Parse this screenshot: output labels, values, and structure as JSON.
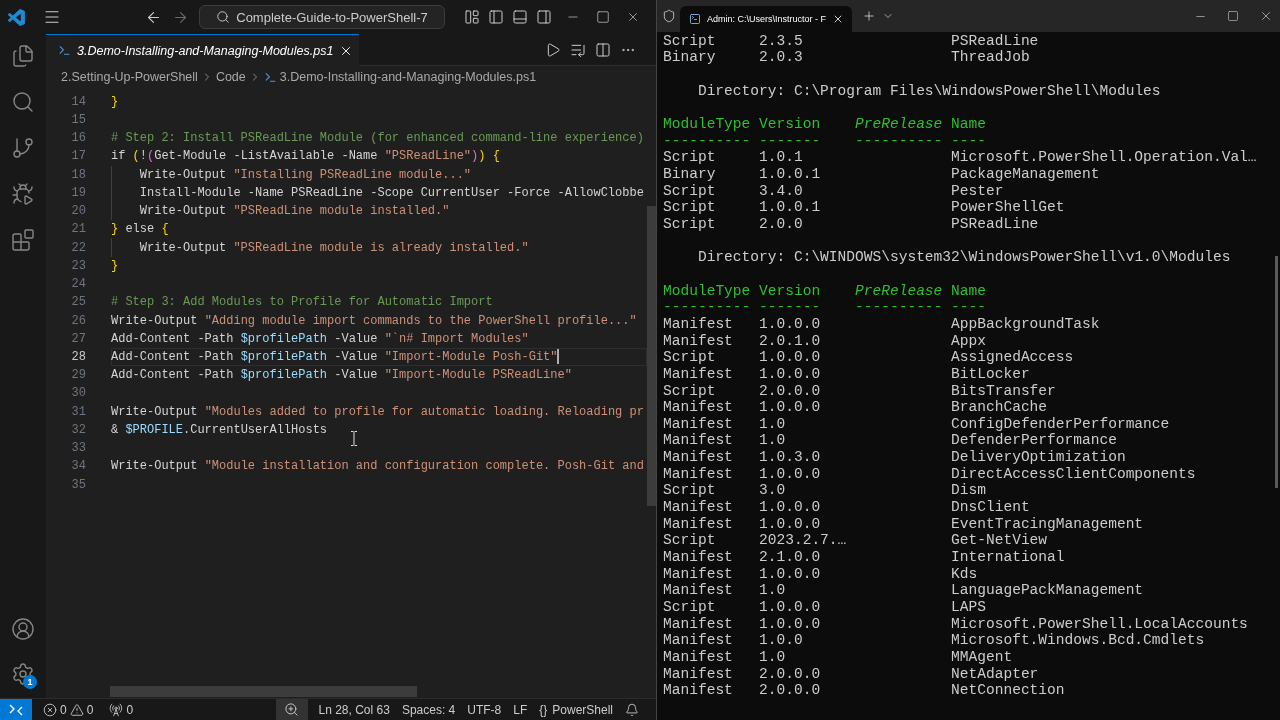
{
  "editor_window": {
    "search": "Complete-Guide-to-PowerShell-7",
    "settings_badge": "1",
    "tabs": [
      {
        "label": "3.Demo-Installing-and-Managing-Modules.ps1",
        "selected": true,
        "preview": true
      }
    ],
    "breadcrumbs": [
      "2.Setting-Up-PowerShell",
      "Code",
      "3.Demo-Installing-and-Managing-Modules.ps1"
    ],
    "code_lines": [
      {
        "number": "14",
        "current": false,
        "indented": false,
        "tokens": [
          {
            "kind": "bracket",
            "text": "}"
          }
        ]
      },
      {
        "number": "15",
        "current": false,
        "indented": false
      },
      {
        "number": "16",
        "current": false,
        "indented": false,
        "tokens": [
          {
            "kind": "comment",
            "text": "# Step 2: Install PSReadLine Module (for enhanced command-line experience)"
          }
        ]
      },
      {
        "number": "17",
        "current": false,
        "indented": false,
        "tokens": [
          {
            "kind": "plain",
            "text": "if "
          },
          {
            "kind": "bracket",
            "text": "("
          },
          {
            "kind": "plain",
            "text": "!"
          },
          {
            "kind": "nested",
            "text": "("
          },
          {
            "kind": "plain",
            "text": "Get-Module -ListAvailable -Name "
          },
          {
            "kind": "string",
            "text": "\"PSReadLine\""
          },
          {
            "kind": "nested",
            "text": ")"
          },
          {
            "kind": "bracket",
            "text": ") {"
          }
        ]
      },
      {
        "number": "18",
        "current": false,
        "indented": true,
        "tokens": [
          {
            "kind": "plain",
            "text": "Write-Output "
          },
          {
            "kind": "string",
            "text": "\"Installing PSReadLine module...\""
          }
        ]
      },
      {
        "number": "19",
        "current": false,
        "indented": true,
        "tokens": [
          {
            "kind": "plain",
            "text": "Install-Module -Name PSReadLine -Scope CurrentUser -Force -AllowClobbe"
          }
        ]
      },
      {
        "number": "20",
        "current": false,
        "indented": true,
        "tokens": [
          {
            "kind": "plain",
            "text": "Write-Output "
          },
          {
            "kind": "string",
            "text": "\"PSReadLine module installed.\""
          }
        ]
      },
      {
        "number": "21",
        "current": false,
        "indented": false,
        "tokens": [
          {
            "kind": "bracket",
            "text": "}"
          },
          {
            "kind": "plain",
            "text": " else "
          },
          {
            "kind": "bracket",
            "text": "{"
          }
        ]
      },
      {
        "number": "22",
        "current": false,
        "indented": true,
        "tokens": [
          {
            "kind": "plain",
            "text": "Write-Output "
          },
          {
            "kind": "string",
            "text": "\"PSReadLine module is already installed.\""
          }
        ]
      },
      {
        "number": "23",
        "current": false,
        "indented": false,
        "tokens": [
          {
            "kind": "bracket",
            "text": "}"
          }
        ]
      },
      {
        "number": "24",
        "current": false,
        "indented": false
      },
      {
        "number": "25",
        "current": false,
        "indented": false,
        "tokens": [
          {
            "kind": "comment",
            "text": "# Step 3: Add Modules to Profile for Automatic Import"
          }
        ]
      },
      {
        "number": "26",
        "current": false,
        "indented": false,
        "tokens": [
          {
            "kind": "plain",
            "text": "Write-Output "
          },
          {
            "kind": "string",
            "text": "\"Adding module import commands to the PowerShell profile...\""
          }
        ]
      },
      {
        "number": "27",
        "current": false,
        "indented": false,
        "tokens": [
          {
            "kind": "plain",
            "text": "Add-Content -Path "
          },
          {
            "kind": "variable",
            "text": "$profilePath"
          },
          {
            "kind": "plain",
            "text": " -Value "
          },
          {
            "kind": "string",
            "text": "\"`n# Import Modules\""
          }
        ]
      },
      {
        "number": "28",
        "current": true,
        "indented": false,
        "tokens": [
          {
            "kind": "plain",
            "text": "Add-Content -Path "
          },
          {
            "kind": "variable",
            "text": "$profilePath"
          },
          {
            "kind": "plain",
            "text": " -Value "
          },
          {
            "kind": "string",
            "text": "\"Import-Module Posh-Git\""
          }
        ]
      },
      {
        "number": "29",
        "current": false,
        "indented": false,
        "tokens": [
          {
            "kind": "plain",
            "text": "Add-Content -Path "
          },
          {
            "kind": "variable",
            "text": "$profilePath"
          },
          {
            "kind": "plain",
            "text": " -Value "
          },
          {
            "kind": "string",
            "text": "\"Import-Module PSReadLine\""
          }
        ]
      },
      {
        "number": "30",
        "current": false,
        "indented": false
      },
      {
        "number": "31",
        "current": false,
        "indented": false,
        "tokens": [
          {
            "kind": "plain",
            "text": "Write-Output "
          },
          {
            "kind": "string",
            "text": "\"Modules added to profile for automatic loading. Reloading pr"
          }
        ]
      },
      {
        "number": "32",
        "current": false,
        "indented": false,
        "tokens": [
          {
            "kind": "plain",
            "text": "& "
          },
          {
            "kind": "variable",
            "text": "$PROFILE"
          },
          {
            "kind": "plain",
            "text": ".CurrentUserAllHosts"
          }
        ]
      },
      {
        "number": "33",
        "current": false,
        "indented": false
      },
      {
        "number": "34",
        "current": false,
        "indented": false,
        "tokens": [
          {
            "kind": "plain",
            "text": "Write-Output "
          },
          {
            "kind": "string",
            "text": "\"Module installation and configuration complete. Posh-Git and"
          }
        ]
      },
      {
        "number": "35",
        "current": false,
        "indented": false
      }
    ],
    "status_bar": {
      "errors": "0",
      "warnings": "0",
      "ports": "0",
      "cursor_position": "Ln 28, Col 63",
      "indentation": "Spaces: 4",
      "encoding": "UTF-8",
      "line_endings": "LF",
      "language_icon": "{}",
      "language": "PowerShell"
    }
  },
  "terminal_window": {
    "tab_title": "Admin: C:\\Users\\Instructor - F",
    "blocks": [
      {
        "kind": "table",
        "rows": [
          {
            "type": "Script",
            "version": "2.3.5",
            "name": "PSReadLine"
          },
          {
            "type": "Binary",
            "version": "2.0.3",
            "name": "ThreadJob"
          }
        ]
      },
      {
        "kind": "directory",
        "text": "Directory: C:\\Program Files\\WindowsPowerShell\\Modules"
      },
      {
        "kind": "table",
        "columns": [
          "ModuleType",
          "Version",
          "PreRelease",
          "Name"
        ],
        "rules": [
          "----------",
          "-------",
          "----------",
          "----"
        ],
        "rows": [
          {
            "type": "Script",
            "version": "1.0.1",
            "name": "Microsoft.PowerShell.Operation.Val…"
          },
          {
            "type": "Binary",
            "version": "1.0.0.1",
            "name": "PackageManagement"
          },
          {
            "type": "Script",
            "version": "3.4.0",
            "name": "Pester"
          },
          {
            "type": "Script",
            "version": "1.0.0.1",
            "name": "PowerShellGet"
          },
          {
            "type": "Script",
            "version": "2.0.0",
            "name": "PSReadLine"
          }
        ]
      },
      {
        "kind": "directory",
        "text": "Directory: C:\\WINDOWS\\system32\\WindowsPowerShell\\v1.0\\Modules"
      },
      {
        "kind": "table",
        "columns": [
          "ModuleType",
          "Version",
          "PreRelease",
          "Name"
        ],
        "rules": [
          "----------",
          "-------",
          "----------",
          "----"
        ],
        "rows": [
          {
            "type": "Manifest",
            "version": "1.0.0.0",
            "name": "AppBackgroundTask"
          },
          {
            "type": "Manifest",
            "version": "2.0.1.0",
            "name": "Appx"
          },
          {
            "type": "Script",
            "version": "1.0.0.0",
            "name": "AssignedAccess"
          },
          {
            "type": "Manifest",
            "version": "1.0.0.0",
            "name": "BitLocker"
          },
          {
            "type": "Script",
            "version": "2.0.0.0",
            "name": "BitsTransfer"
          },
          {
            "type": "Manifest",
            "version": "1.0.0.0",
            "name": "BranchCache"
          },
          {
            "type": "Manifest",
            "version": "1.0",
            "name": "ConfigDefenderPerformance"
          },
          {
            "type": "Manifest",
            "version": "1.0",
            "name": "DefenderPerformance"
          },
          {
            "type": "Manifest",
            "version": "1.0.3.0",
            "name": "DeliveryOptimization"
          },
          {
            "type": "Manifest",
            "version": "1.0.0.0",
            "name": "DirectAccessClientComponents"
          },
          {
            "type": "Script",
            "version": "3.0",
            "name": "Dism"
          },
          {
            "type": "Manifest",
            "version": "1.0.0.0",
            "name": "DnsClient"
          },
          {
            "type": "Manifest",
            "version": "1.0.0.0",
            "name": "EventTracingManagement"
          },
          {
            "type": "Script",
            "version": "2023.2.7.…",
            "name": "Get-NetView"
          },
          {
            "type": "Manifest",
            "version": "2.1.0.0",
            "name": "International"
          },
          {
            "type": "Manifest",
            "version": "1.0.0.0",
            "name": "Kds"
          },
          {
            "type": "Manifest",
            "version": "1.0",
            "name": "LanguagePackManagement"
          },
          {
            "type": "Script",
            "version": "1.0.0.0",
            "name": "LAPS"
          },
          {
            "type": "Manifest",
            "version": "1.0.0.0",
            "name": "Microsoft.PowerShell.LocalAccounts"
          },
          {
            "type": "Manifest",
            "version": "1.0.0",
            "name": "Microsoft.Windows.Bcd.Cmdlets"
          },
          {
            "type": "Manifest",
            "version": "1.0",
            "name": "MMAgent"
          },
          {
            "type": "Manifest",
            "version": "2.0.0.0",
            "name": "NetAdapter"
          },
          {
            "type": "Manifest",
            "version": "2.0.0.0",
            "name": "NetConnection"
          }
        ]
      }
    ]
  }
}
